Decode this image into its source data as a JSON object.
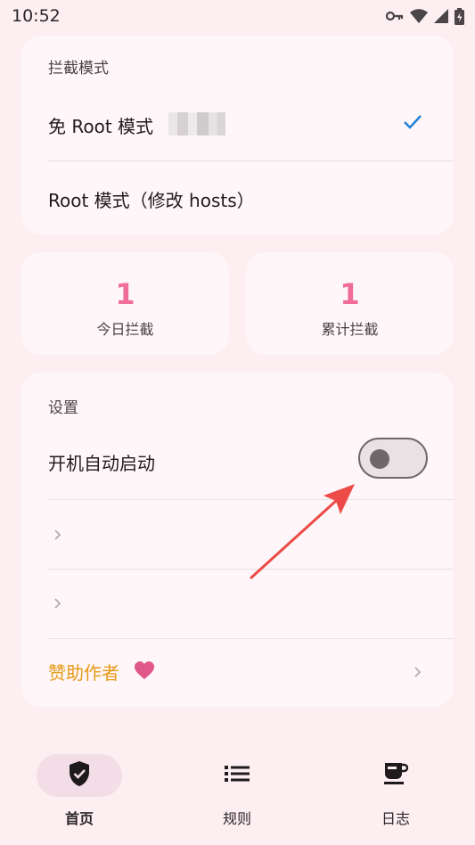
{
  "status_bar": {
    "time": "10:52",
    "icons": [
      "vpn-key-icon",
      "wifi-icon",
      "cellular-signal-icon",
      "battery-charging-icon"
    ]
  },
  "block_mode": {
    "title": "拦截模式",
    "options": [
      {
        "label": "免 Root 模式",
        "selected": true
      },
      {
        "label": "Root 模式（修改 hosts）",
        "selected": false
      }
    ]
  },
  "stats": [
    {
      "value": "1",
      "label": "今日拦截"
    },
    {
      "value": "1",
      "label": "累计拦截"
    }
  ],
  "settings": {
    "title": "设置",
    "autostart_label": "开机自动启动",
    "autostart_enabled": false,
    "sponsor_label": "赞助作者",
    "sponsor_icon": "heart-icon"
  },
  "bottom_nav": {
    "items": [
      {
        "label": "首页",
        "icon": "shield-check-icon",
        "active": true
      },
      {
        "label": "规则",
        "icon": "list-icon",
        "active": false
      },
      {
        "label": "日志",
        "icon": "coffee-cup-icon",
        "active": false
      }
    ]
  },
  "colors": {
    "background": "#fdeef1",
    "card": "#fef6f8",
    "accent_pink": "#f06d98",
    "check_blue": "#1e7fd8",
    "sponsor_orange": "#e79a17",
    "annotation_arrow": "#ec4b47"
  }
}
